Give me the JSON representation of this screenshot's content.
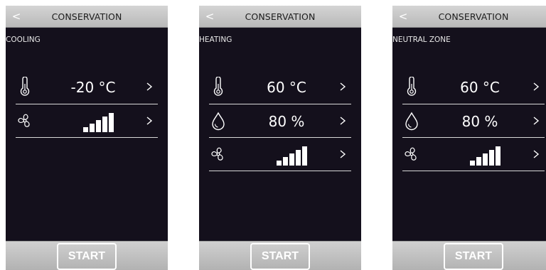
{
  "screens": [
    {
      "header": {
        "back_glyph": "<",
        "title": "CONSERVATION"
      },
      "mode": "COOLING",
      "rows": [
        {
          "icon": "thermometer-icon",
          "value": "-20 °C"
        },
        {
          "icon": "fan-icon",
          "fan_level": 5,
          "fan_max": 5
        }
      ],
      "start_label": "START"
    },
    {
      "header": {
        "back_glyph": "<",
        "title": "CONSERVATION"
      },
      "mode": "HEATING",
      "rows": [
        {
          "icon": "thermometer-icon",
          "value": "60 °C"
        },
        {
          "icon": "humidity-drop-icon",
          "value": "80 %"
        },
        {
          "icon": "fan-icon",
          "fan_level": 5,
          "fan_max": 5
        }
      ],
      "start_label": "START"
    },
    {
      "header": {
        "back_glyph": "<",
        "title": "CONSERVATION"
      },
      "mode": "NEUTRAL ZONE",
      "rows": [
        {
          "icon": "thermometer-icon",
          "value": "60 °C"
        },
        {
          "icon": "humidity-drop-icon",
          "value": "80 %"
        },
        {
          "icon": "fan-icon",
          "fan_level": 5,
          "fan_max": 5
        }
      ],
      "start_label": "START"
    }
  ],
  "colors": {
    "screen_bg": "#14101c",
    "bar_gray": "#bdbdbd",
    "text": "#ffffff"
  }
}
